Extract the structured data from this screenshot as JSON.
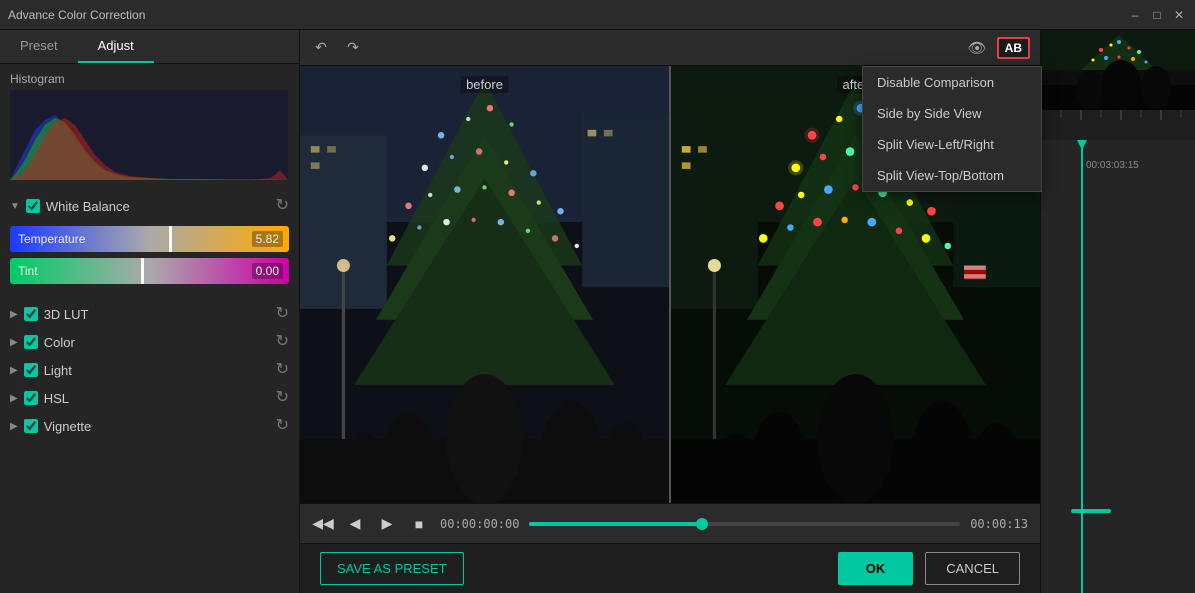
{
  "window": {
    "title": "Advance Color Correction",
    "controls": [
      "minimize",
      "maximize",
      "close"
    ]
  },
  "tabs": [
    {
      "id": "preset",
      "label": "Preset"
    },
    {
      "id": "adjust",
      "label": "Adjust",
      "active": true
    }
  ],
  "histogram": {
    "label": "Histogram"
  },
  "sections": [
    {
      "id": "white-balance",
      "label": "White Balance",
      "expanded": true,
      "enabled": true,
      "sliders": [
        {
          "id": "temperature",
          "label": "Temperature",
          "value": "5.82",
          "thumbPos": "57%"
        },
        {
          "id": "tint",
          "label": "Tint",
          "value": "0.00",
          "thumbPos": "47%"
        }
      ]
    },
    {
      "id": "3d-lut",
      "label": "3D LUT",
      "expanded": false,
      "enabled": true
    },
    {
      "id": "color",
      "label": "Color",
      "expanded": false,
      "enabled": true
    },
    {
      "id": "light",
      "label": "Light",
      "expanded": false,
      "enabled": true
    },
    {
      "id": "hsl",
      "label": "HSL",
      "expanded": false,
      "enabled": true
    },
    {
      "id": "vignette",
      "label": "Vignette",
      "expanded": false,
      "enabled": true
    }
  ],
  "comparison_dropdown": {
    "items": [
      "Disable Comparison",
      "Side by Side View",
      "Split View-Left/Right",
      "Split View-Top/Bottom"
    ]
  },
  "video": {
    "before_label": "before",
    "after_label": "after",
    "time_current": "00:00:00:00",
    "time_total": "00:00:13",
    "timeline_time": "00:03:03:15"
  },
  "footer": {
    "save_preset_label": "SAVE AS PRESET",
    "ok_label": "OK",
    "cancel_label": "CANCEL"
  }
}
